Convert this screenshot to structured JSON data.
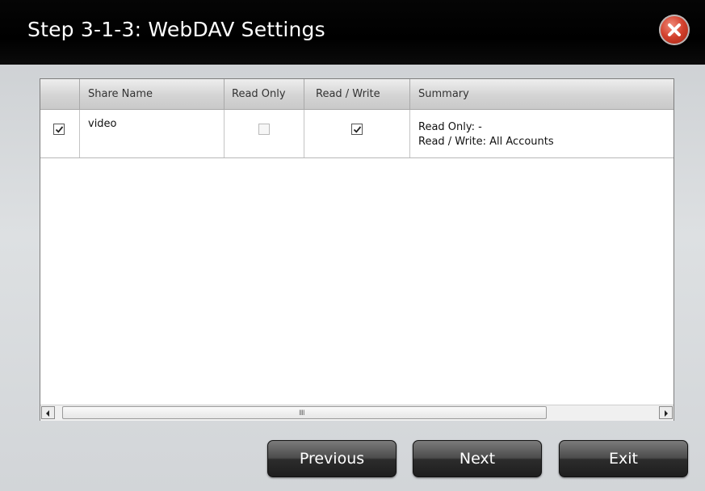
{
  "window": {
    "title": "Step 3-1-3: WebDAV Settings"
  },
  "table": {
    "columns": [
      "",
      "Share Name",
      "Read Only",
      "Read / Write",
      "Summary"
    ],
    "rows": [
      {
        "selected": true,
        "share_name": "video",
        "read_only": false,
        "read_write": true,
        "summary_line1": "Read Only: -",
        "summary_line2": "Read / Write: All Accounts"
      }
    ]
  },
  "scrollbar": {
    "grip": "IIII"
  },
  "buttons": {
    "previous": "Previous",
    "next": "Next",
    "exit": "Exit"
  },
  "icons": {
    "close": "close-icon",
    "scroll_left": "arrow-left-icon",
    "scroll_right": "arrow-right-icon",
    "check": "checkmark-icon"
  },
  "colors": {
    "titlebar": "#000000",
    "close": "#d2402c",
    "button": "#2c2c2c"
  }
}
